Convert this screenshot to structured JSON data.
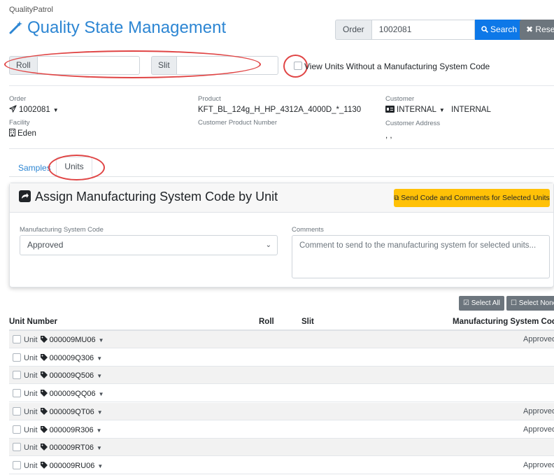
{
  "app": {
    "brand": "QualityPatrol",
    "title": "Quality State Management"
  },
  "search": {
    "order_label": "Order",
    "order_value": "1002081",
    "search_label": "Search",
    "reset_label": "Reset"
  },
  "filters": {
    "roll_label": "Roll",
    "roll_value": "",
    "slit_label": "Slit",
    "slit_value": "",
    "view_without_code_label": "View Units Without a Manufacturing System Code",
    "view_without_code_checked": false
  },
  "details": {
    "order_label": "Order",
    "order_value": "1002081",
    "facility_label": "Facility",
    "facility_value": "Eden",
    "product_label": "Product",
    "product_value": "KFT_BL_124g_H_HP_4312A_4000D_*_1130",
    "customer_product_number_label": "Customer Product Number",
    "customer_product_number_value": "",
    "customer_label": "Customer",
    "customer_value": "INTERNAL",
    "customer_name": "INTERNAL",
    "customer_address_label": "Customer Address",
    "customer_address_value": ", ,"
  },
  "tabs": [
    {
      "label": "Samples",
      "active": false
    },
    {
      "label": "Units",
      "active": true
    }
  ],
  "assign_card": {
    "title": "Assign Manufacturing System Code by Unit",
    "send_button": "Send Code and Comments for Selected Units",
    "msc_label": "Manufacturing System Code",
    "msc_selected": "Approved",
    "comments_label": "Comments",
    "comments_placeholder": "Comment to send to the manufacturing system for selected units..."
  },
  "selection": {
    "select_all": "Select All",
    "select_none": "Select None"
  },
  "table": {
    "columns": [
      "Unit Number",
      "Roll",
      "Slit",
      "Manufacturing System Code"
    ],
    "row_prefix": "Unit",
    "rows": [
      {
        "unit": "000009MU06",
        "roll": "",
        "slit": "",
        "msc": "Approved"
      },
      {
        "unit": "000009Q306",
        "roll": "",
        "slit": "",
        "msc": ""
      },
      {
        "unit": "000009Q506",
        "roll": "",
        "slit": "",
        "msc": ""
      },
      {
        "unit": "000009QQ06",
        "roll": "",
        "slit": "",
        "msc": ""
      },
      {
        "unit": "000009QT06",
        "roll": "",
        "slit": "",
        "msc": "Approved"
      },
      {
        "unit": "000009R306",
        "roll": "",
        "slit": "",
        "msc": "Approved"
      },
      {
        "unit": "000009RT06",
        "roll": "",
        "slit": "",
        "msc": ""
      },
      {
        "unit": "000009RU06",
        "roll": "",
        "slit": "",
        "msc": "Approved"
      }
    ]
  },
  "colors": {
    "primary": "#0d78e8",
    "title_blue": "#2d86d3",
    "warning": "#ffc107",
    "secondary": "#6c757d",
    "annotation_red": "#e04545"
  }
}
